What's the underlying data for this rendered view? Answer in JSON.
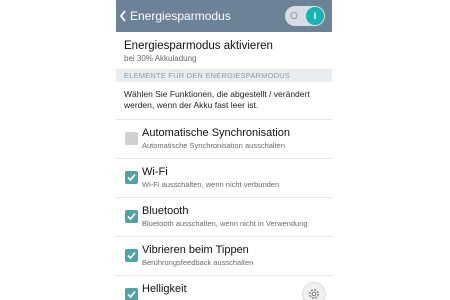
{
  "header": {
    "title": "Energiesparmodus",
    "back_icon": "chevron-left-icon",
    "toggle_off_label": "O",
    "toggle_on_label": "I",
    "accent": "#6c8397",
    "toggle_color": "#17b4b4"
  },
  "saver": {
    "title": "Energiesparmodus aktivieren",
    "subtitle": "bei 30% Akkuladung"
  },
  "section": {
    "title": "ELEMENTE FÜR DEN ENERGIESPARMODUS",
    "description": "Wählen Sie Funktionen, die abgestellt / verändert werden, wenn der Akku fast leer ist."
  },
  "items": [
    {
      "title": "Automatische Synchronisation",
      "subtitle": "Automatische Synchronisation ausschalten",
      "checked": false
    },
    {
      "title": "Wi-Fi",
      "subtitle": "Wi-Fi ausschalten, wenn nicht verbunden",
      "checked": true
    },
    {
      "title": "Bluetooth",
      "subtitle": "Bluetooth ausschalten, wenn nicht in Verwendung",
      "checked": true
    },
    {
      "title": "Vibrieren beim Tippen",
      "subtitle": "Berührungsfeedback ausschalten",
      "checked": true
    },
    {
      "title": "Helligkeit",
      "subtitle": "",
      "checked": true,
      "settings_icon": "gear-icon"
    }
  ]
}
